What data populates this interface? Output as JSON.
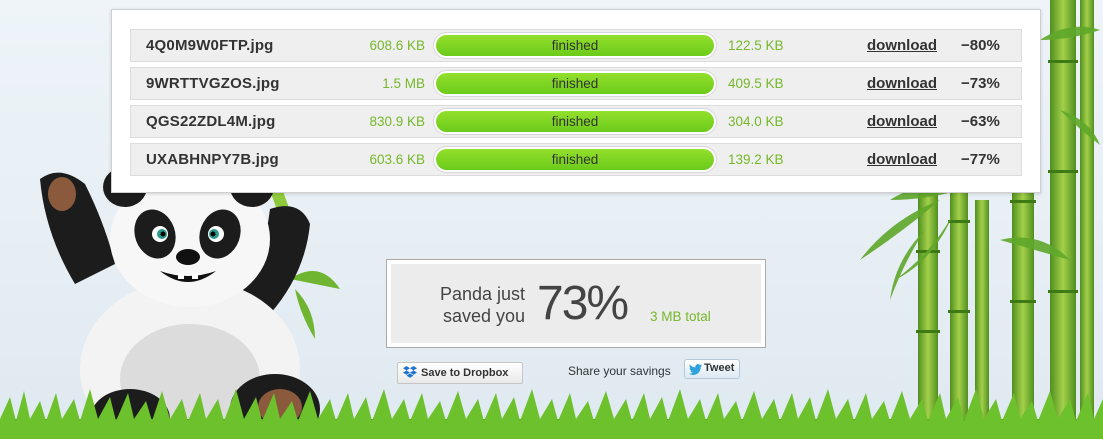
{
  "files": [
    {
      "name": "4Q0M9W0FTP.jpg",
      "original": "608.6 KB",
      "status": "finished",
      "compressed": "122.5 KB",
      "action": "download",
      "savings": "−80%"
    },
    {
      "name": "9WRTTVGZOS.jpg",
      "original": "1.5 MB",
      "status": "finished",
      "compressed": "409.5 KB",
      "action": "download",
      "savings": "−73%"
    },
    {
      "name": "QGS22ZDL4M.jpg",
      "original": "830.9 KB",
      "status": "finished",
      "compressed": "304.0 KB",
      "action": "download",
      "savings": "−63%"
    },
    {
      "name": "UXABHNPY7B.jpg",
      "original": "603.6 KB",
      "status": "finished",
      "compressed": "139.2 KB",
      "action": "download",
      "savings": "−77%"
    }
  ],
  "summary": {
    "line1": "Panda just",
    "line2": "saved you",
    "percent": "73%",
    "total": "3 MB total"
  },
  "actions": {
    "dropbox_label": "Save to Dropbox",
    "share_label": "Share your savings",
    "tweet_label": "Tweet"
  },
  "colors": {
    "progress_green": "#7ed321",
    "size_text_green": "#76b82a"
  },
  "icons": {
    "mascot": "panda-mascot",
    "decoration": "bamboo",
    "ground": "grass"
  }
}
